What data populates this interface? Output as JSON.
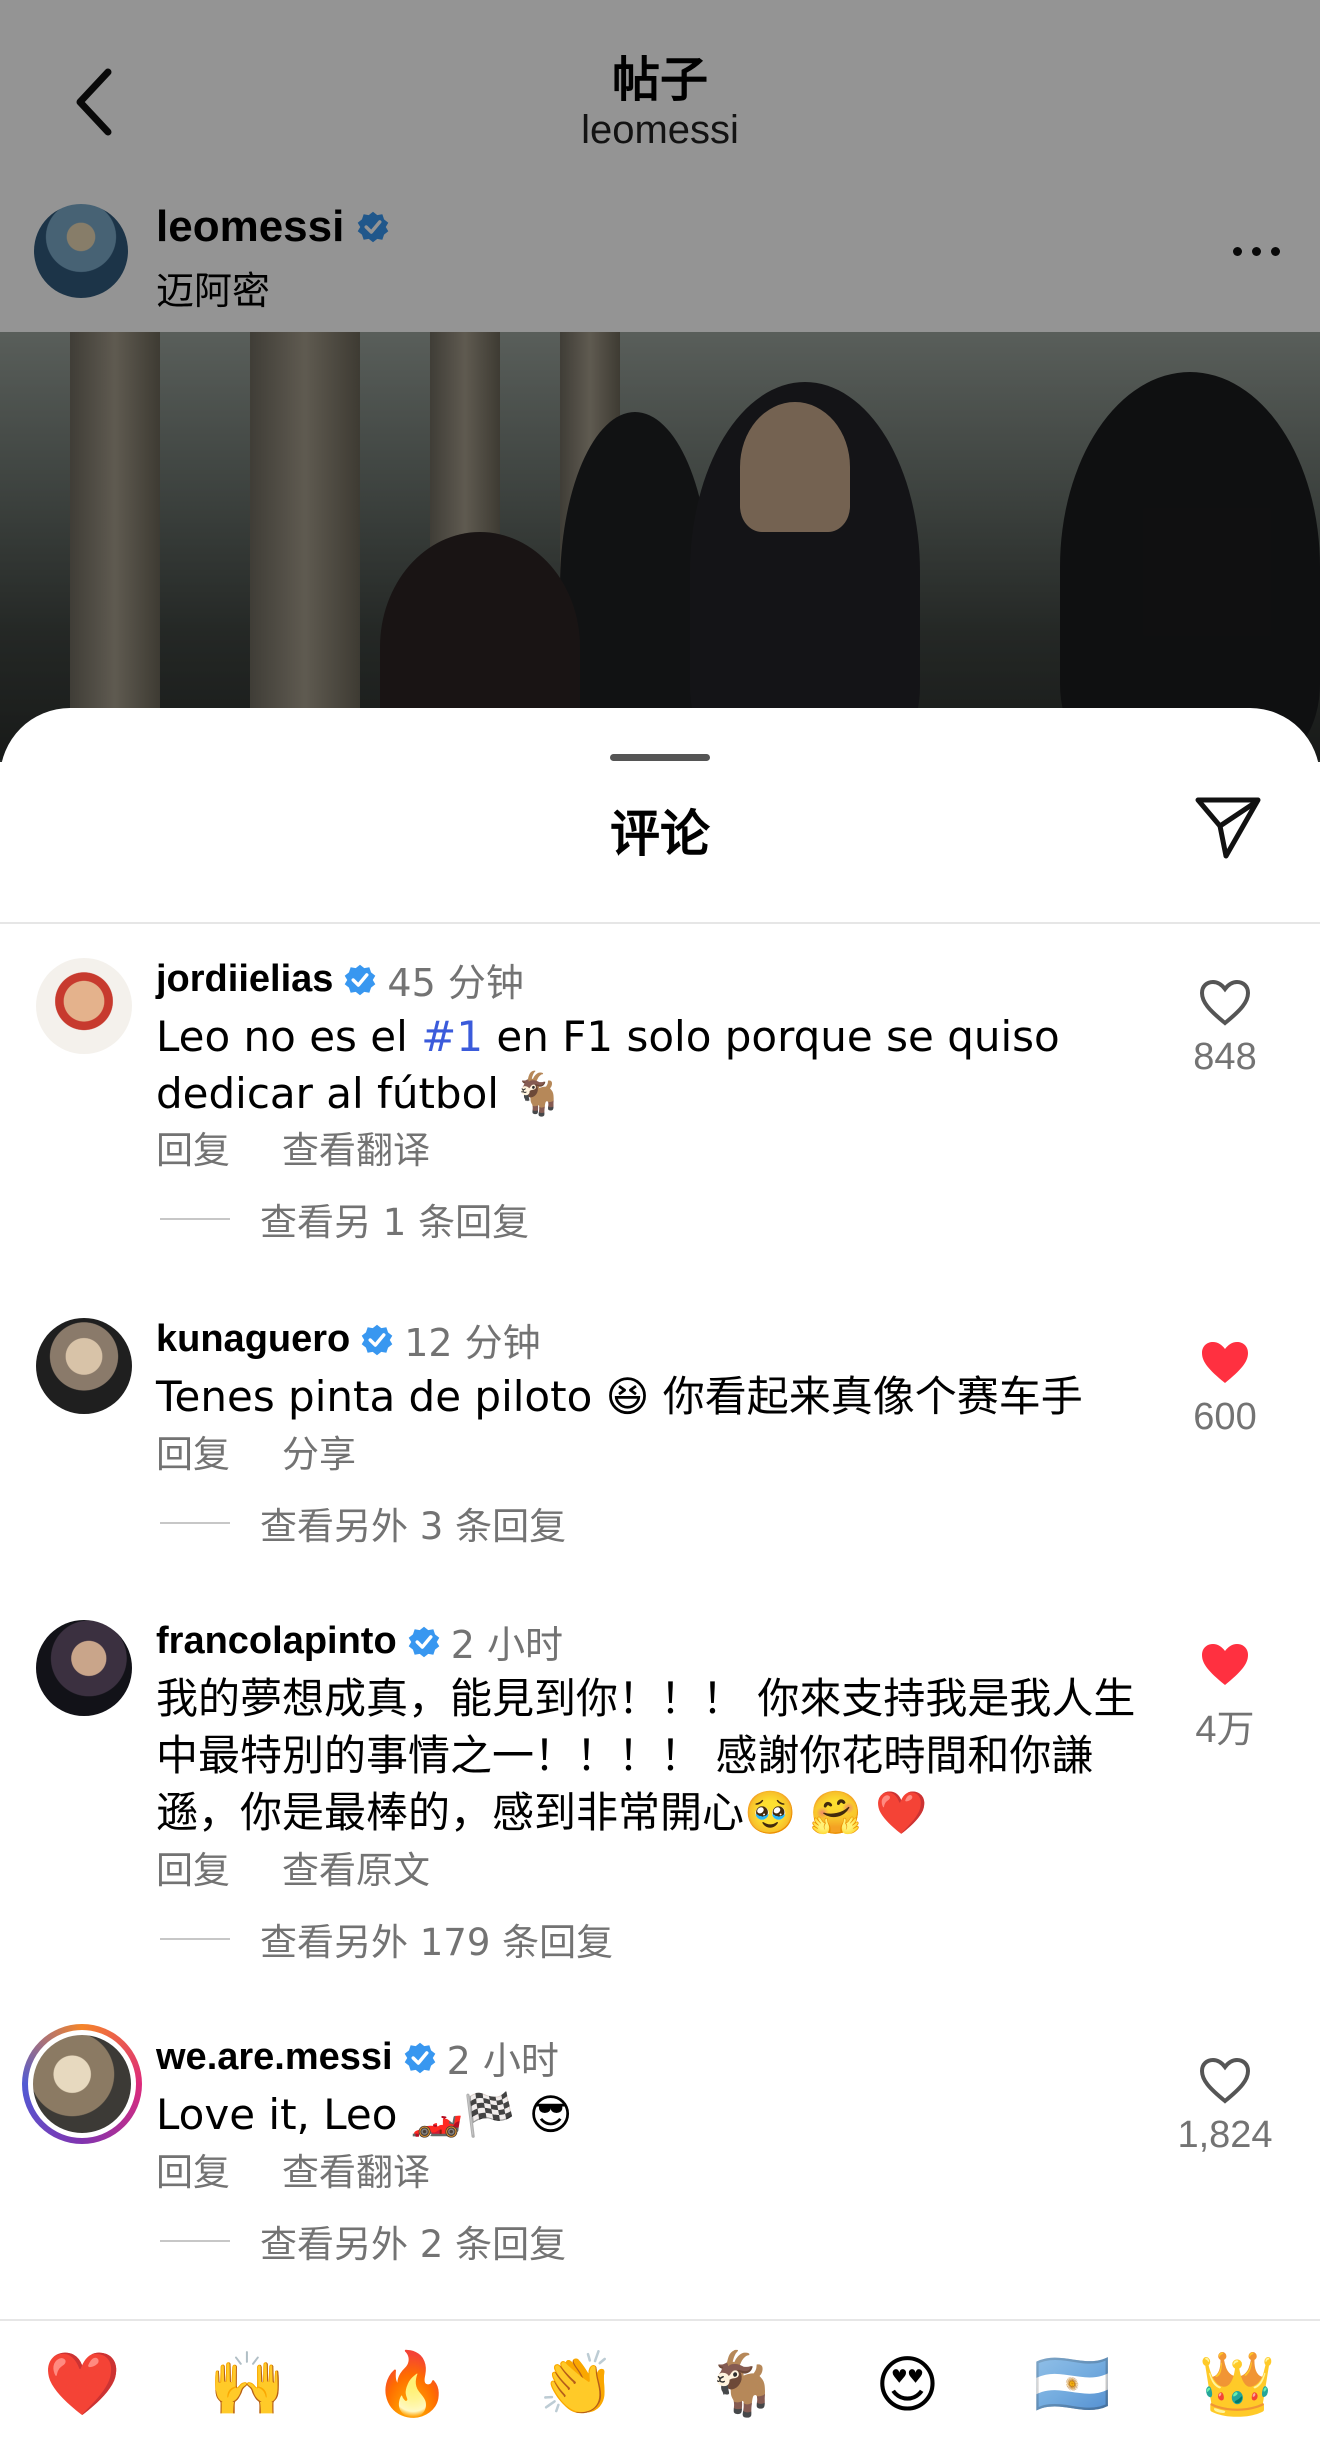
{
  "header": {
    "title": "帖子",
    "subtitle": "leomessi"
  },
  "post": {
    "username": "leomessi",
    "location": "迈阿密"
  },
  "sheet": {
    "title": "评论"
  },
  "comments": [
    {
      "username": "jordiielias",
      "time": "45 分钟",
      "text_before": "Leo no es el ",
      "tag": "#1",
      "text_after": " en F1 solo porque se quiso dedicar al fútbol 🐐",
      "actions": [
        "回复",
        "查看翻译"
      ],
      "replies": "查看另 1 条回复",
      "likes": "848",
      "liked": false
    },
    {
      "username": "kunaguero",
      "time": "12 分钟",
      "text": "Tenes pinta de piloto 😆 你看起来真像个赛车手",
      "actions": [
        "回复",
        "分享"
      ],
      "replies": "查看另外 3 条回复",
      "likes": "600",
      "liked": true
    },
    {
      "username": "francolapinto",
      "time": "2 小时",
      "text": "我的夢想成真，能見到你！！！ 你來支持我是我人生中最特別的事情之一！！！！ 感謝你花時間和你謙遜，你是最棒的，感到非常開心🥹 🤗 ❤️",
      "actions": [
        "回复",
        "查看原文"
      ],
      "replies": "查看另外 179 条回复",
      "likes": "4万",
      "liked": true
    },
    {
      "username": "we.are.messi",
      "time": "2 小时",
      "text": "Love it, Leo 🏎️🏁 😎",
      "actions": [
        "回复",
        "查看翻译"
      ],
      "replies": "查看另外 2 条回复",
      "likes": "1,824",
      "liked": false
    }
  ],
  "emoji_bar": [
    "❤️",
    "🙌",
    "🔥",
    "👏",
    "🐐",
    "😍",
    "🇦🇷",
    "👑"
  ],
  "colors": {
    "verified": "#3897f0",
    "like_red": "#ff3040",
    "tag_blue": "#3b5bdb"
  }
}
